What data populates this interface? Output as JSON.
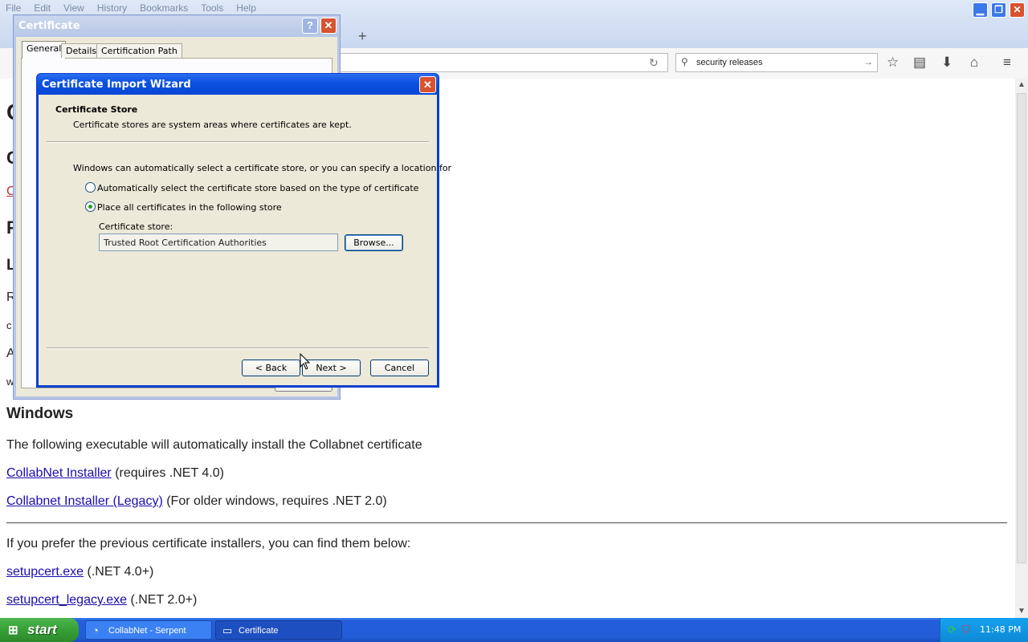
{
  "browser": {
    "menu": [
      "File",
      "Edit",
      "View",
      "History",
      "Bookmarks",
      "Tools",
      "Help"
    ],
    "search_value": "security releases",
    "new_tab_symbol": "+"
  },
  "page": {
    "windows_heading": "Windows",
    "windows_desc": "The following executable will automatically install the Collabnet certificate",
    "link1": "CollabNet Installer",
    "link1_note": "(requires .NET 4.0)",
    "link2": "Collabnet Installer (Legacy)",
    "link2_note": "(For older windows, requires .NET 2.0)",
    "prev_text": "If you prefer the previous certificate installers, you can find them below:",
    "link3": "setupcert.exe",
    "link3_note": "(.NET 4.0+)",
    "link4": "setupcert_legacy.exe",
    "link4_note": "(.NET 2.0+)",
    "partial_left": [
      "C",
      "C",
      "C",
      "F",
      "L",
      "R",
      "c",
      "A",
      "w"
    ]
  },
  "cert_dialog": {
    "title": "Certificate",
    "tabs": [
      "General",
      "Details",
      "Certification Path"
    ],
    "help_symbol": "?",
    "close_symbol": "✕"
  },
  "wizard": {
    "title": "Certificate Import Wizard",
    "heading": "Certificate Store",
    "subheading": "Certificate stores are system areas where certificates are kept.",
    "description": "Windows can automatically select a certificate store, or you can specify a location for",
    "option_auto": "Automatically select the certificate store based on the type of certificate",
    "option_place": "Place all certificates in the following store",
    "selected_option": "place",
    "store_label": "Certificate store:",
    "store_value": "Trusted Root Certification Authorities",
    "browse": "Browse...",
    "back": "< Back",
    "next": "Next >",
    "cancel": "Cancel",
    "close_symbol": "✕"
  },
  "taskbar": {
    "start": "start",
    "tasks": [
      "CollabNet - Serpent",
      "Certificate"
    ],
    "time": "11:48 PM"
  },
  "colors": {
    "xp_blue": "#0845d6",
    "dialog_face": "#ece9d8",
    "link": "#1a0dab",
    "taskbar": "#245edb",
    "start_green": "#36a036"
  }
}
